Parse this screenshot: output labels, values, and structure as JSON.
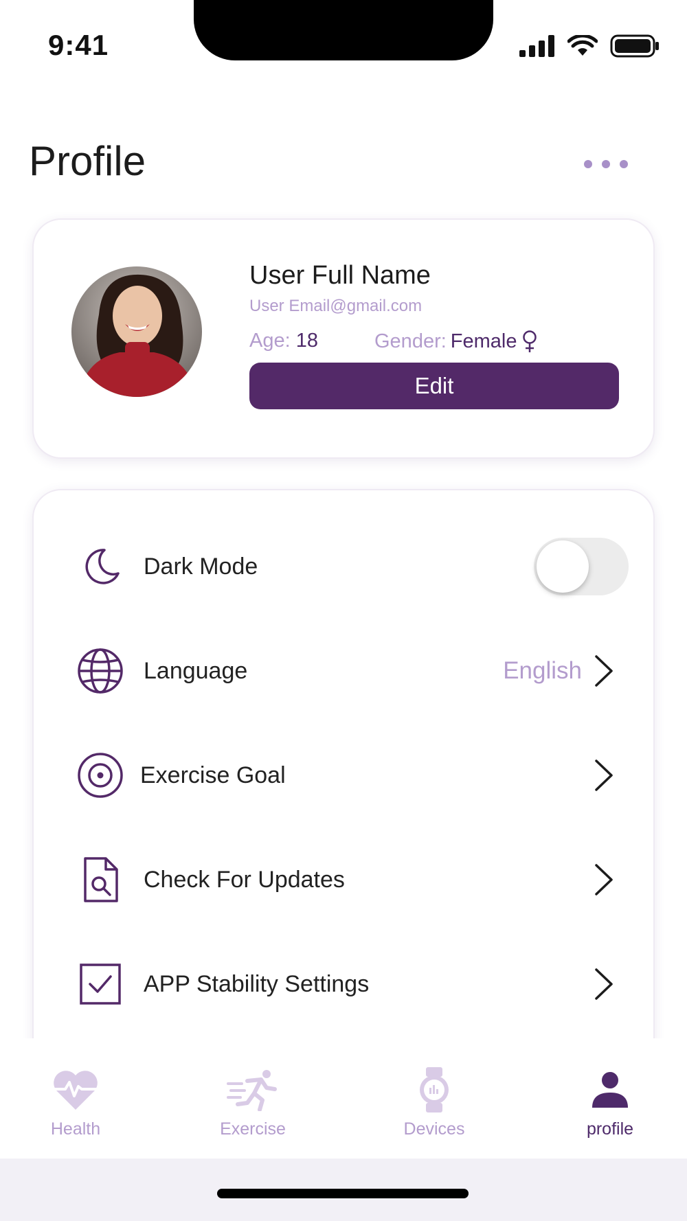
{
  "status_bar": {
    "time": "9:41"
  },
  "header": {
    "title": "Profile"
  },
  "profile": {
    "name": "User Full Name",
    "email": "User Email@gmail.com",
    "age_label": "Age:",
    "age_value": "18",
    "gender_label": "Gender:",
    "gender_value": "Female",
    "edit_label": "Edit"
  },
  "settings": {
    "dark_mode": {
      "label": "Dark Mode",
      "enabled": false
    },
    "language": {
      "label": "Language",
      "value": "English"
    },
    "exercise_goal": {
      "label": "Exercise Goal"
    },
    "check_updates": {
      "label": "Check For Updates"
    },
    "app_stability": {
      "label": "APP Stability Settings"
    }
  },
  "tabs": [
    {
      "label": "Health",
      "icon": "heart-pulse-icon",
      "active": false
    },
    {
      "label": "Exercise",
      "icon": "running-icon",
      "active": false
    },
    {
      "label": "Devices",
      "icon": "watch-icon",
      "active": false
    },
    {
      "label": "profile",
      "icon": "person-icon",
      "active": true
    }
  ],
  "colors": {
    "accent": "#532968",
    "muted": "#b39ccd",
    "toggle_off": "#ececec"
  }
}
